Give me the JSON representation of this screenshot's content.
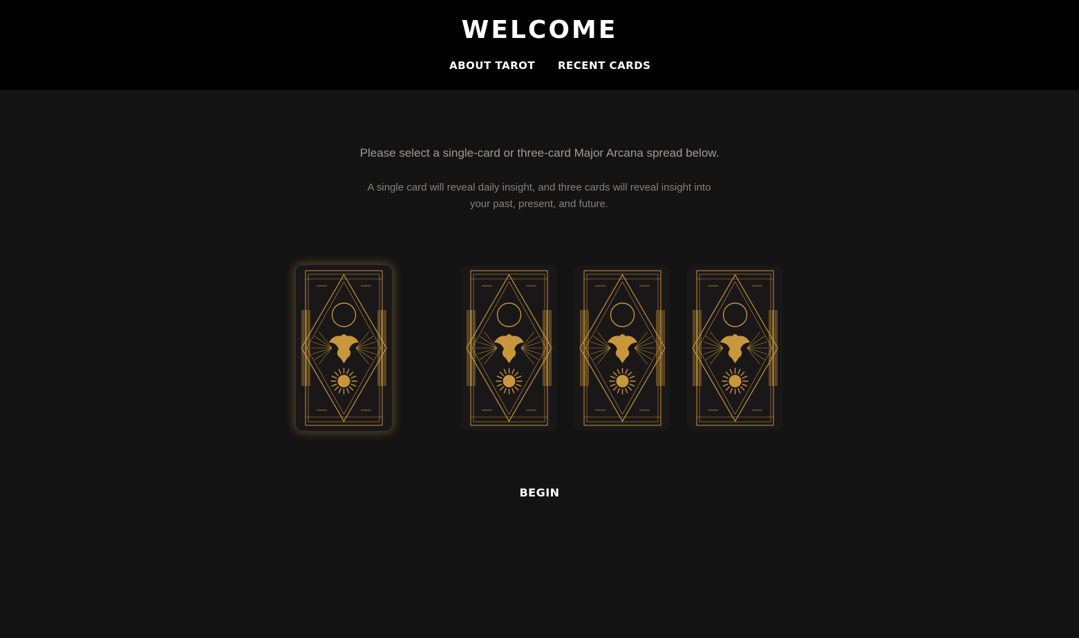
{
  "header": {
    "title": "WELCOME",
    "nav": [
      {
        "label": "ABOUT TAROT"
      },
      {
        "label": "RECENT CARDS"
      }
    ]
  },
  "main": {
    "instruction": "Please select a single-card or three-card Major Arcana spread below.",
    "description": "A single card will reveal daily insight, and three cards will reveal insight into your past, present, and future.",
    "begin_label": "BEGIN"
  },
  "colors": {
    "header_bg": "#000000",
    "page_bg": "#131313",
    "card_bg": "#1a1718",
    "card_gold": "#c8963c",
    "selected_glow": "#c8a05a"
  },
  "spreads": {
    "single": {
      "selected": true,
      "icon": "tarot-card-back"
    },
    "three": {
      "selected": false,
      "icon": "tarot-card-back"
    }
  }
}
